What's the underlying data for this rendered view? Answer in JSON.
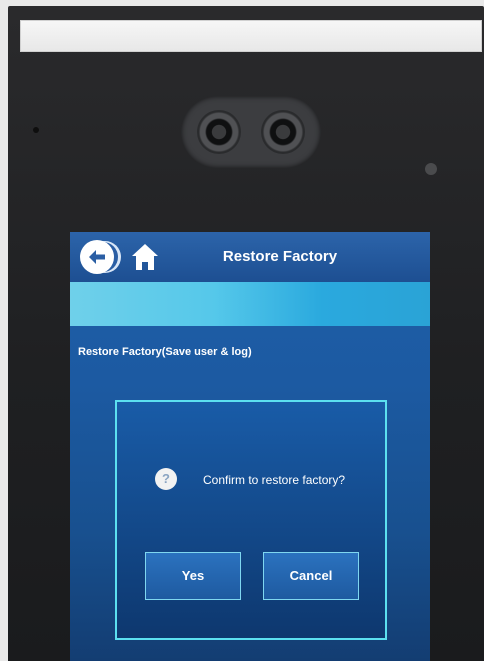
{
  "header": {
    "title": "Restore Factory"
  },
  "main": {
    "option_label": "Restore Factory(Save user & log)"
  },
  "dialog": {
    "message": "Confirm to restore factory?",
    "icon_glyph": "?",
    "yes_label": "Yes",
    "cancel_label": "Cancel"
  },
  "icons": {
    "back": "back-arrow-icon",
    "home": "home-icon",
    "question": "question-icon"
  },
  "colors": {
    "screen_bg": "#1f5fa8",
    "info_bar": "#55c8ea",
    "dialog_border": "#5ce0f0"
  }
}
